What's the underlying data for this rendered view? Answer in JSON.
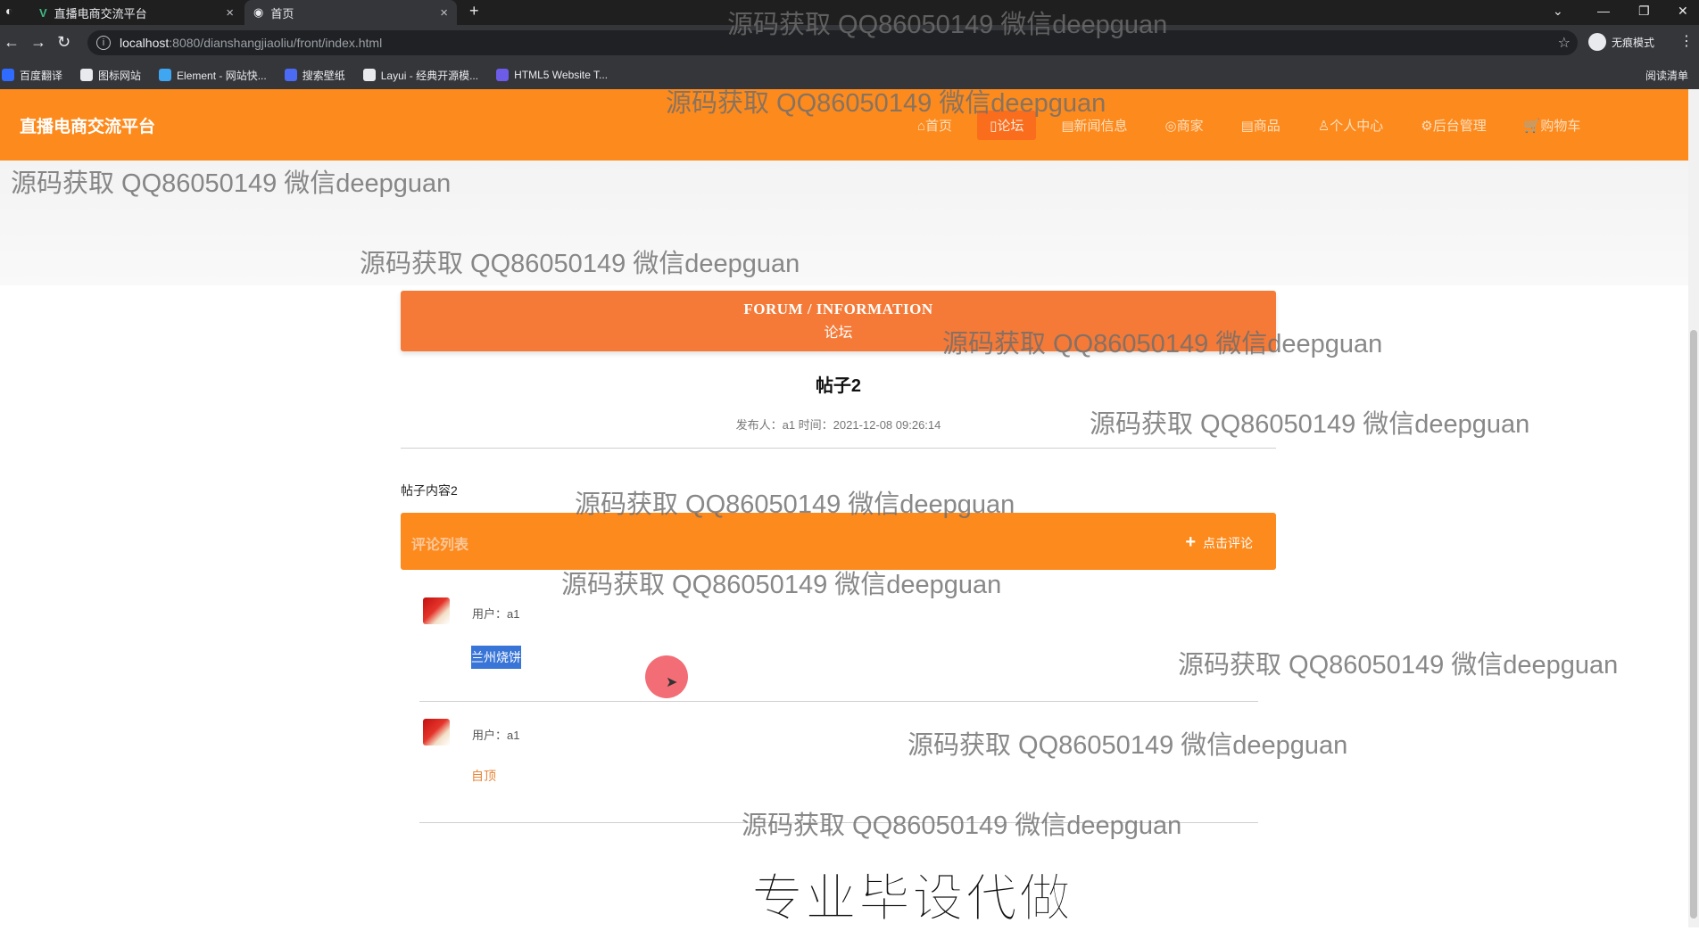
{
  "browser": {
    "tabs": [
      {
        "title": "直播电商交流平台",
        "close": "×",
        "icon": "vue-icon"
      },
      {
        "title": "首页",
        "close": "×",
        "icon": "globe-icon"
      }
    ],
    "new_tab": "+",
    "url_host": "localhost",
    "url_path": ":8080/dianshangjiaoliu/front/index.html",
    "incognito_label": "无痕模式",
    "bookmarks": [
      {
        "label": "百度翻译",
        "color": "#2f6bff"
      },
      {
        "label": "图标网站",
        "color": "#1a1a1a"
      },
      {
        "label": "Element - 网站快...",
        "color": "#3fa6f2"
      },
      {
        "label": "搜索壁纸",
        "color": "#4b6bf5"
      },
      {
        "label": "Layui - 经典开源模...",
        "color": "#222222"
      },
      {
        "label": "HTML5 Website T...",
        "color": "#6c5ce7"
      }
    ],
    "reading_list": "阅读清单"
  },
  "site": {
    "brand": "直播电商交流平台",
    "nav": [
      {
        "label": "⌂首页",
        "active": false
      },
      {
        "label": "▯论坛",
        "active": true
      },
      {
        "label": "▤新闻信息",
        "active": false
      },
      {
        "label": "◎商家",
        "active": false
      },
      {
        "label": "▤商品",
        "active": false
      },
      {
        "label": "♙个人中心",
        "active": false
      },
      {
        "label": "⚙后台管理",
        "active": false
      },
      {
        "label": "🛒购物车",
        "active": false
      }
    ],
    "accent": "#fd8a1d"
  },
  "forum": {
    "header_en": "FORUM / INFORMATION",
    "header_cn": "论坛",
    "post_title": "帖子2",
    "post_meta": "发布人：a1 时间：2021-12-08 09:26:14",
    "post_content": "帖子内容2",
    "comment_list_label": "评论列表",
    "add_comment_label": "点击评论",
    "comments": [
      {
        "user": "用户：a1",
        "text": "兰州烧饼",
        "selected": true
      },
      {
        "user": "用户：a1",
        "text": "自顶",
        "selected": false
      }
    ]
  },
  "watermarks": {
    "text": "源码获取 QQ86050149 微信deepguan",
    "caption": "专业毕设代做"
  }
}
